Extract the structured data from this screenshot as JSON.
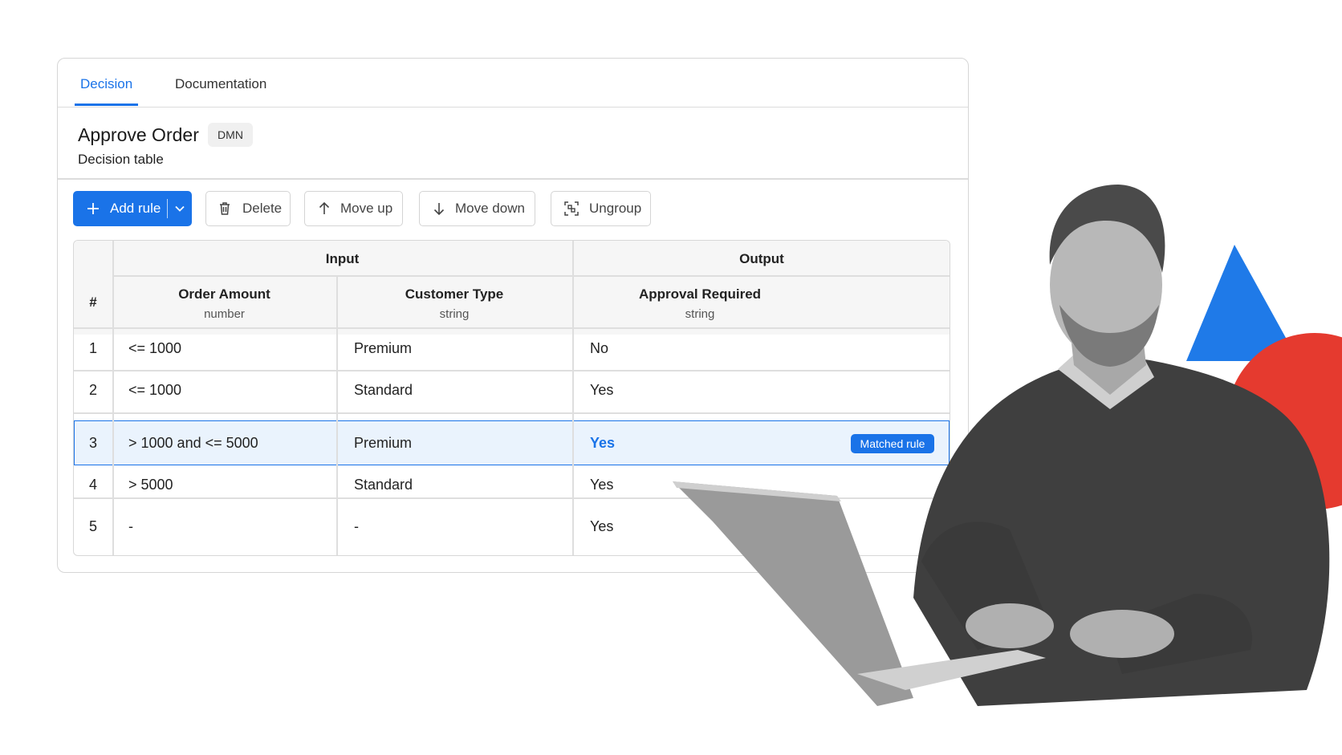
{
  "tabs": [
    {
      "label": "Decision",
      "active": true
    },
    {
      "label": "Documentation",
      "active": false
    }
  ],
  "decision": {
    "title": "Approve Order",
    "badge": "DMN",
    "subtitle": "Decision table"
  },
  "toolbar": {
    "add_rule": "Add rule",
    "delete": "Delete",
    "move_up": "Move up",
    "move_down": "Move down",
    "ungroup": "Ungroup"
  },
  "table": {
    "index_header": "#",
    "groups": {
      "input": "Input",
      "output": "Output"
    },
    "columns": [
      {
        "name": "Order Amount",
        "type": "number"
      },
      {
        "name": "Customer Type",
        "type": "string"
      },
      {
        "name": "Approval Required",
        "type": "string"
      }
    ],
    "rows": [
      {
        "n": "1",
        "amount": "<= 1000",
        "customer": "Premium",
        "approval": "No"
      },
      {
        "n": "2",
        "amount": "<= 1000",
        "customer": "Standard",
        "approval": "Yes"
      },
      {
        "n": "3",
        "amount": "> 1000 and <= 5000",
        "customer": "Premium",
        "approval": "Yes"
      },
      {
        "n": "4",
        "amount": "> 5000",
        "customer": "Standard",
        "approval": "Yes"
      },
      {
        "n": "5",
        "amount": "-",
        "customer": "-",
        "approval": "Yes"
      }
    ],
    "matched_badge": "Matched rule"
  },
  "colors": {
    "accent": "#1a73e8",
    "highlight_row": "#eaf3fd",
    "deco_triangle": "#1f7ae8",
    "deco_circle": "#e53a2f"
  }
}
